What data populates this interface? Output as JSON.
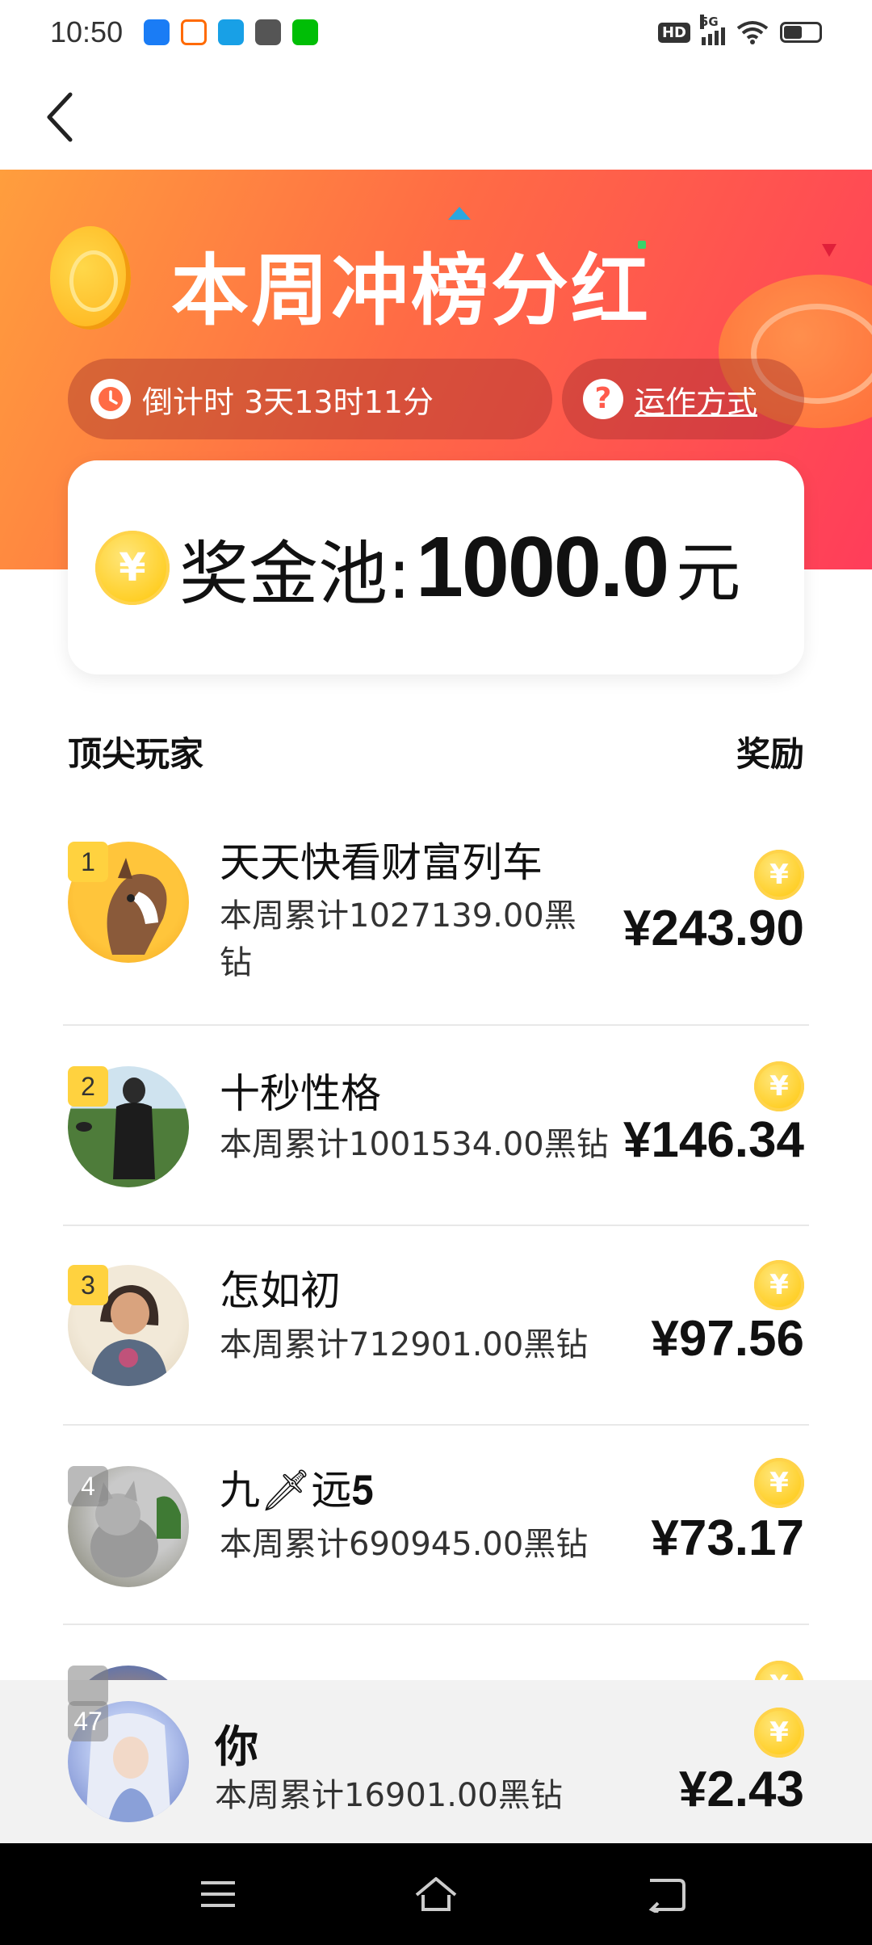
{
  "status_bar": {
    "time": "10:50",
    "hd": "HD",
    "network": "5G",
    "app_icons": [
      {
        "name": "tencent-video",
        "color": "#1a7cf5"
      },
      {
        "name": "taobao",
        "color": "#ff6a00"
      },
      {
        "name": "ele-me",
        "color": "#18a0e6"
      },
      {
        "name": "gift",
        "color": "#555555"
      },
      {
        "name": "iqiyi",
        "color": "#00be06"
      }
    ]
  },
  "hero": {
    "title": "本周冲榜分红",
    "countdown_label": "倒计时 3天13时11分",
    "how_it_works": "运作方式"
  },
  "prize_pool": {
    "label": "奖金池:",
    "amount": "1000.0",
    "unit": "元"
  },
  "list_header": {
    "left": "顶尖玩家",
    "right": "奖励"
  },
  "players": [
    {
      "rank": "1",
      "name": "天天快看财富列车",
      "stat": "本周累计1027139.00黑钻",
      "reward": "¥243.90"
    },
    {
      "rank": "2",
      "name": "十秒性格",
      "stat": "本周累计1001534.00黑钻",
      "reward": "¥146.34"
    },
    {
      "rank": "3",
      "name": "怎如初",
      "stat": "本周累计712901.00黑钻",
      "reward": "¥97.56"
    },
    {
      "rank": "4",
      "name": "九🗡远𝟓",
      "stat": "本周累计690945.00黑钻",
      "reward": "¥73.17"
    }
  ],
  "current_user": {
    "rank": "47",
    "name": "你",
    "stat": "本周累计16901.00黑钻",
    "reward": "¥2.43"
  },
  "colors": {
    "hero_gradient_start": "#ff9e3d",
    "hero_gradient_end": "#ff3d5a",
    "coin": "#ffc400",
    "rank_badge": "#ffd23f"
  }
}
